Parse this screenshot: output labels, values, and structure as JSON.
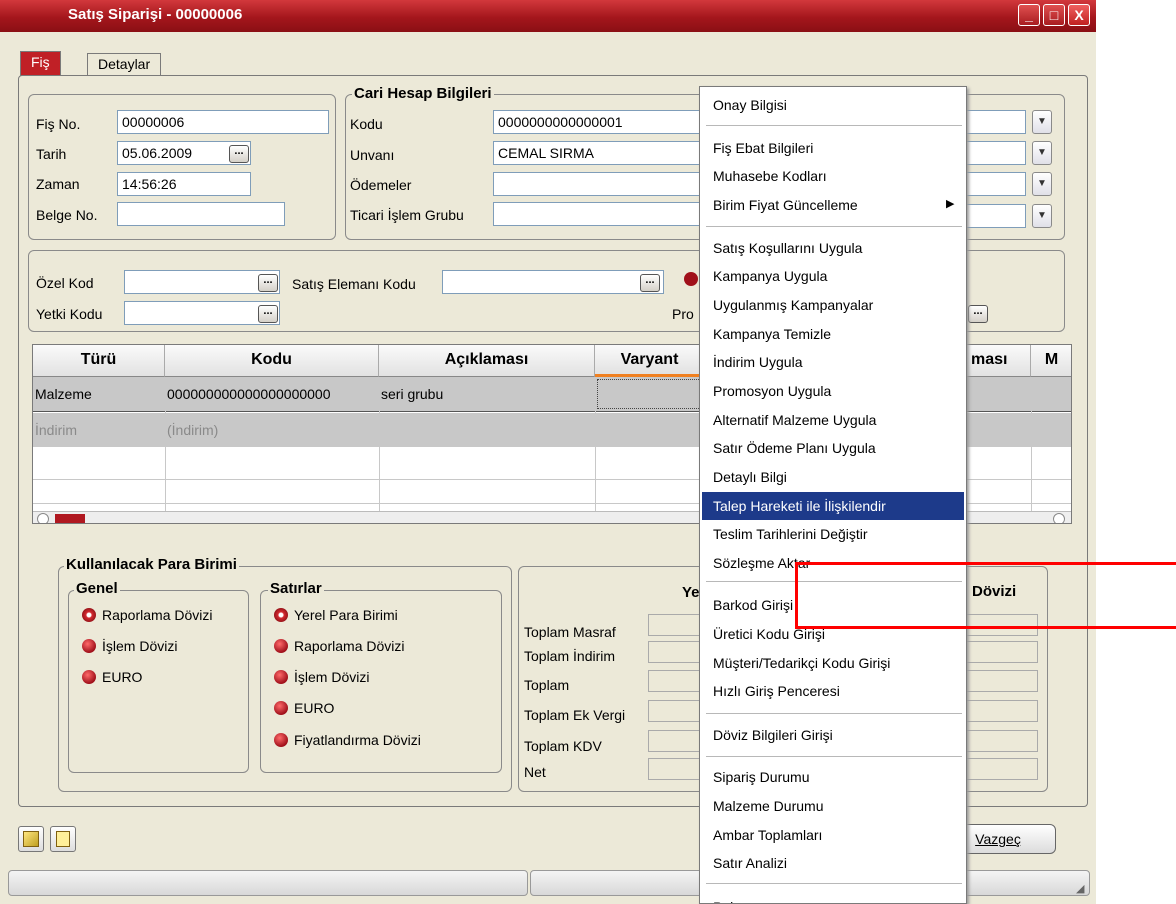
{
  "window": {
    "title": "Satış Siparişi - 00000006",
    "min": "_",
    "max": "□",
    "close": "X"
  },
  "tabs": [
    {
      "label": "Fiş"
    },
    {
      "label": "Detaylar"
    }
  ],
  "fis": {
    "fisno_label": "Fiş No.",
    "fisno": "00000006",
    "tarih_label": "Tarih",
    "tarih": "05.06.2009",
    "zaman_label": "Zaman",
    "zaman": "14:56:26",
    "belge_label": "Belge No.",
    "belge": ""
  },
  "cari": {
    "title": "Cari Hesap Bilgileri",
    "kodu_label": "Kodu",
    "kodu": "0000000000000001",
    "unvan_label": "Unvanı",
    "unvan": "CEMAL SIRMA",
    "odeme_label": "Ödemeler",
    "ticari_label": "Ticari İşlem Grubu"
  },
  "codes": {
    "ozel_label": "Özel Kod",
    "yetki_label": "Yetki Kodu",
    "satis_label": "Satış Elemanı Kodu",
    "pro_label": "Pro"
  },
  "grid": {
    "headers": [
      "Türü",
      "Kodu",
      "Açıklaması",
      "Varyant",
      "ması",
      "M"
    ],
    "row1": [
      "Malzeme",
      "000000000000000000000",
      "seri grubu"
    ],
    "row2": [
      "İndirim",
      "(İndirim)"
    ]
  },
  "para": {
    "title": "Kullanılacak Para Birimi",
    "genel_title": "Genel",
    "genel": [
      "Raporlama Dövizi",
      "İşlem Dövizi",
      "EURO"
    ],
    "satir_title": "Satırlar",
    "satirlar": [
      "Yerel Para Birimi",
      "Raporlama Dövizi",
      "İşlem Dövizi",
      "EURO",
      "Fiyatlandırma Dövizi"
    ]
  },
  "totals": {
    "yer": "Yer",
    "dovizi": "Dövizi",
    "labels": [
      "Toplam Masraf",
      "Toplam İndirim",
      "Toplam",
      "Toplam Ek Vergi",
      "Toplam KDV",
      "Net"
    ]
  },
  "buttons": {
    "vazgec": "Vazgeç"
  },
  "menu": {
    "items": [
      "Onay Bilgisi",
      "Fiş Ebat Bilgileri",
      "Muhasebe Kodları",
      "Birim Fiyat Güncelleme",
      "Satış Koşullarını Uygula",
      "Kampanya Uygula",
      "Uygulanmış Kampanyalar",
      "Kampanya Temizle",
      "İndirim Uygula",
      "Promosyon Uygula",
      "Alternatif Malzeme Uygula",
      "Satır Ödeme Planı Uygula",
      "Detaylı Bilgi",
      "Talep Hareketi ile İlişkilendir",
      "Teslim Tarihlerini Değiştir",
      "Sözleşme Aktar",
      "Barkod Girişi",
      "Üretici Kodu Girişi",
      "Müşteri/Tedarikçi Kodu Girişi",
      "Hızlı Giriş Penceresi",
      "Döviz Bilgileri Girişi",
      "Sipariş Durumu",
      "Malzeme Durumu",
      "Ambar Toplamları",
      "Satır Analizi",
      "Pul"
    ],
    "highlighted": "Talep Hareketi ile İlişkilendir",
    "submenu_arrow": "▶"
  },
  "colors": {
    "title": "#a4161c",
    "highlight": "#1d3a8a",
    "annotation": "#ff0000"
  }
}
